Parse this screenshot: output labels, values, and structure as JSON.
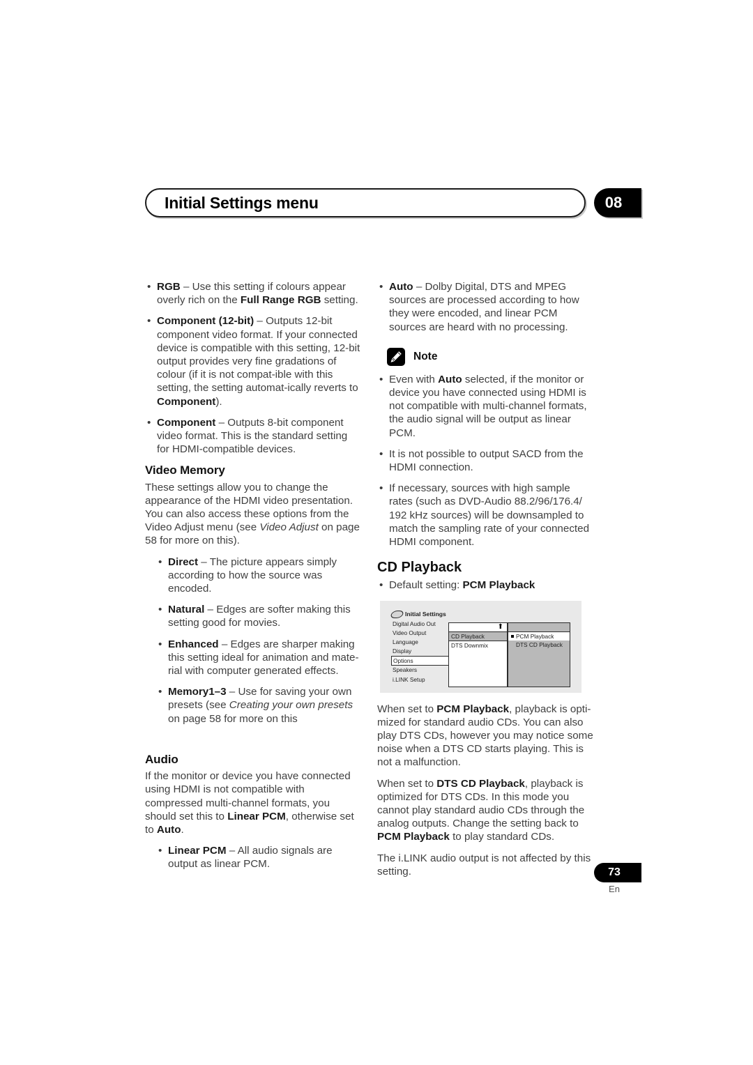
{
  "header": {
    "title": "Initial Settings menu",
    "chapter_number": "08"
  },
  "footer": {
    "page_number": "73",
    "language_code": "En"
  },
  "left_column": {
    "hdmi_bullets": [
      {
        "bold": "RGB",
        "dash": " – ",
        "text": "Use this setting if colours appear overly rich on the ",
        "bold2": "Full Range RGB",
        "text2": " setting."
      },
      {
        "bold": "Component (12-bit)",
        "dash": " – ",
        "text": "Outputs 12-bit component video format. If your connected device is compatible with this setting, 12-bit output provides very fine gradations of colour (if it is not compat-ible with this setting, the setting automat-ically reverts to ",
        "bold2": "Component",
        "text2": ")."
      },
      {
        "bold": "Component",
        "dash": " – ",
        "text": "Outputs 8-bit component video format. This is the standard setting for HDMI-compatible devices.",
        "bold2": "",
        "text2": ""
      }
    ],
    "video_memory": {
      "heading": "Video Memory",
      "intro_part1": "These settings allow you to change the appearance of the HDMI video presentation. You can also access these options from the Video Adjust menu (see ",
      "intro_italic": "Video Adjust",
      "intro_part2": " on page 58 for more on this).",
      "bullets": [
        {
          "bold": "Direct",
          "dash": " – ",
          "text": "The picture appears simply according to how the source was encoded."
        },
        {
          "bold": "Natural",
          "dash": " – ",
          "text": "Edges are softer making this setting good for movies."
        },
        {
          "bold": "Enhanced",
          "dash": " – ",
          "text": "Edges are sharper making this setting ideal for animation and mate-rial with computer generated effects."
        }
      ],
      "memory_bullet": {
        "bold": "Memory1–3",
        "dash": " – ",
        "text": "Use for saving your own presets (see ",
        "italic": "Creating your own presets",
        "text2": " on page 58 for more on this"
      }
    },
    "audio": {
      "heading": "Audio",
      "intro_part1": "If the monitor or device you have connected using HDMI is not compatible with compressed multi-channel formats, you should set this to ",
      "intro_bold1": "Linear PCM",
      "intro_part2": ", otherwise set to ",
      "intro_bold2": "Auto",
      "intro_part3": ".",
      "bullet": {
        "bold": "Linear PCM",
        "dash": " – ",
        "text": "All audio signals are output as linear PCM."
      }
    }
  },
  "right_column": {
    "auto_bullet": {
      "bold": "Auto",
      "dash": " – ",
      "text": "Dolby Digital, DTS and MPEG sources are processed according to how they were encoded, and linear PCM sources are heard with no processing."
    },
    "note": {
      "icon": "pencil-icon",
      "label": "Note",
      "bullets": [
        {
          "text_before": "Even with ",
          "bold": "Auto",
          "text_after": " selected, if the monitor or device you have connected using HDMI is not compatible with multi-channel formats, the audio signal will be output as linear PCM."
        },
        {
          "text_before": "It is not possible to output SACD from the HDMI connection.",
          "bold": "",
          "text_after": ""
        },
        {
          "text_before": "If necessary, sources with high sample rates (such as DVD-Audio 88.2/96/176.4/ 192 kHz sources) will be downsampled to match the sampling rate of your connected HDMI component.",
          "bold": "",
          "text_after": ""
        }
      ]
    },
    "cd_playback": {
      "heading": "CD Playback",
      "default_bullet_label": "Default setting: ",
      "default_bullet_value": "PCM Playback",
      "osd": {
        "title": "Initial Settings",
        "title_icon": "disc-icon",
        "left_menu": [
          {
            "label": "Digital Audio Out",
            "selected": false
          },
          {
            "label": "Video Output",
            "selected": false
          },
          {
            "label": "Language",
            "selected": false
          },
          {
            "label": "Display",
            "selected": false
          },
          {
            "label": "Options",
            "selected": true
          },
          {
            "label": "Speakers",
            "selected": false
          },
          {
            "label": "i.LINK Setup",
            "selected": false
          }
        ],
        "middle_panel": {
          "arrow_icon": "up-arrow-icon",
          "rows": [
            {
              "label": "CD Playback",
              "highlighted": true
            },
            {
              "label": "DTS Downmix",
              "highlighted": false
            }
          ]
        },
        "right_panel": {
          "rows": [
            {
              "label": "PCM Playback",
              "selected": true
            },
            {
              "label": "DTS CD Playback",
              "selected": false
            }
          ]
        }
      },
      "body_paragraphs": [
        {
          "part1": "When set to ",
          "bold1": "PCM Playback",
          "part2": ", playback is opti-mized for standard audio CDs. You can also play DTS CDs, however you may notice some noise when a DTS CD starts playing. This is not a malfunction.",
          "bold2": "",
          "part3": ""
        },
        {
          "part1": "When set to ",
          "bold1": "DTS CD Playback",
          "part2": ", playback is optimized for DTS CDs. In this mode you cannot play standard audio CDs through the analog outputs. Change the setting back to ",
          "bold2": "PCM Playback",
          "part3": " to play standard CDs."
        },
        {
          "part1": "The i.LINK audio output is not affected by this setting.",
          "bold1": "",
          "part2": "",
          "bold2": "",
          "part3": ""
        }
      ]
    }
  }
}
